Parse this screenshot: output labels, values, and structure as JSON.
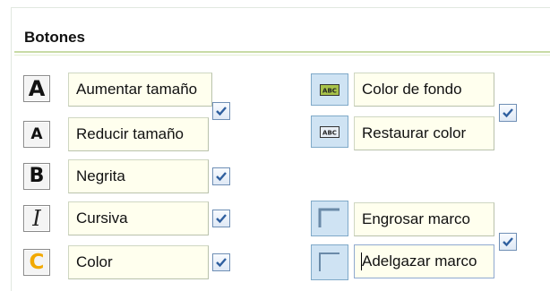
{
  "section": {
    "title": "Botones"
  },
  "buttons": {
    "increase_size": "Aumentar tamaño",
    "reduce_size": "Reducir tamaño",
    "bold": "Negrita",
    "italic": "Cursiva",
    "color": "Color",
    "background_color": "Color de fondo",
    "restore_color": "Restaurar color",
    "thicken_border": "Engrosar marco",
    "thin_border": "Adelgazar marco"
  },
  "icons": {
    "increase_size": "large-letter-a-icon",
    "reduce_size": "small-letter-a-icon",
    "bold": "bold-letter-b-icon",
    "italic": "italic-letter-i-icon",
    "color": "letter-c-color-icon",
    "background_color": "abc-highlight-icon",
    "restore_color": "abc-restore-icon",
    "thicken_border": "thick-border-icon",
    "thin_border": "thin-border-icon"
  },
  "icon_glyphs": {
    "increase_size": "A",
    "reduce_size": "A",
    "bold": "B",
    "italic": "I",
    "color": "C",
    "background_color": "ABC",
    "restore_color": "ABC"
  },
  "checkboxes": {
    "size_group": true,
    "bold": true,
    "italic": true,
    "color": true,
    "bg_group": true,
    "border_group": true
  },
  "colors": {
    "field_bg": "#ffffee",
    "accent_green": "#c8dba6",
    "check_blue": "#2f5f9f",
    "color_icon": "#f2a900"
  }
}
